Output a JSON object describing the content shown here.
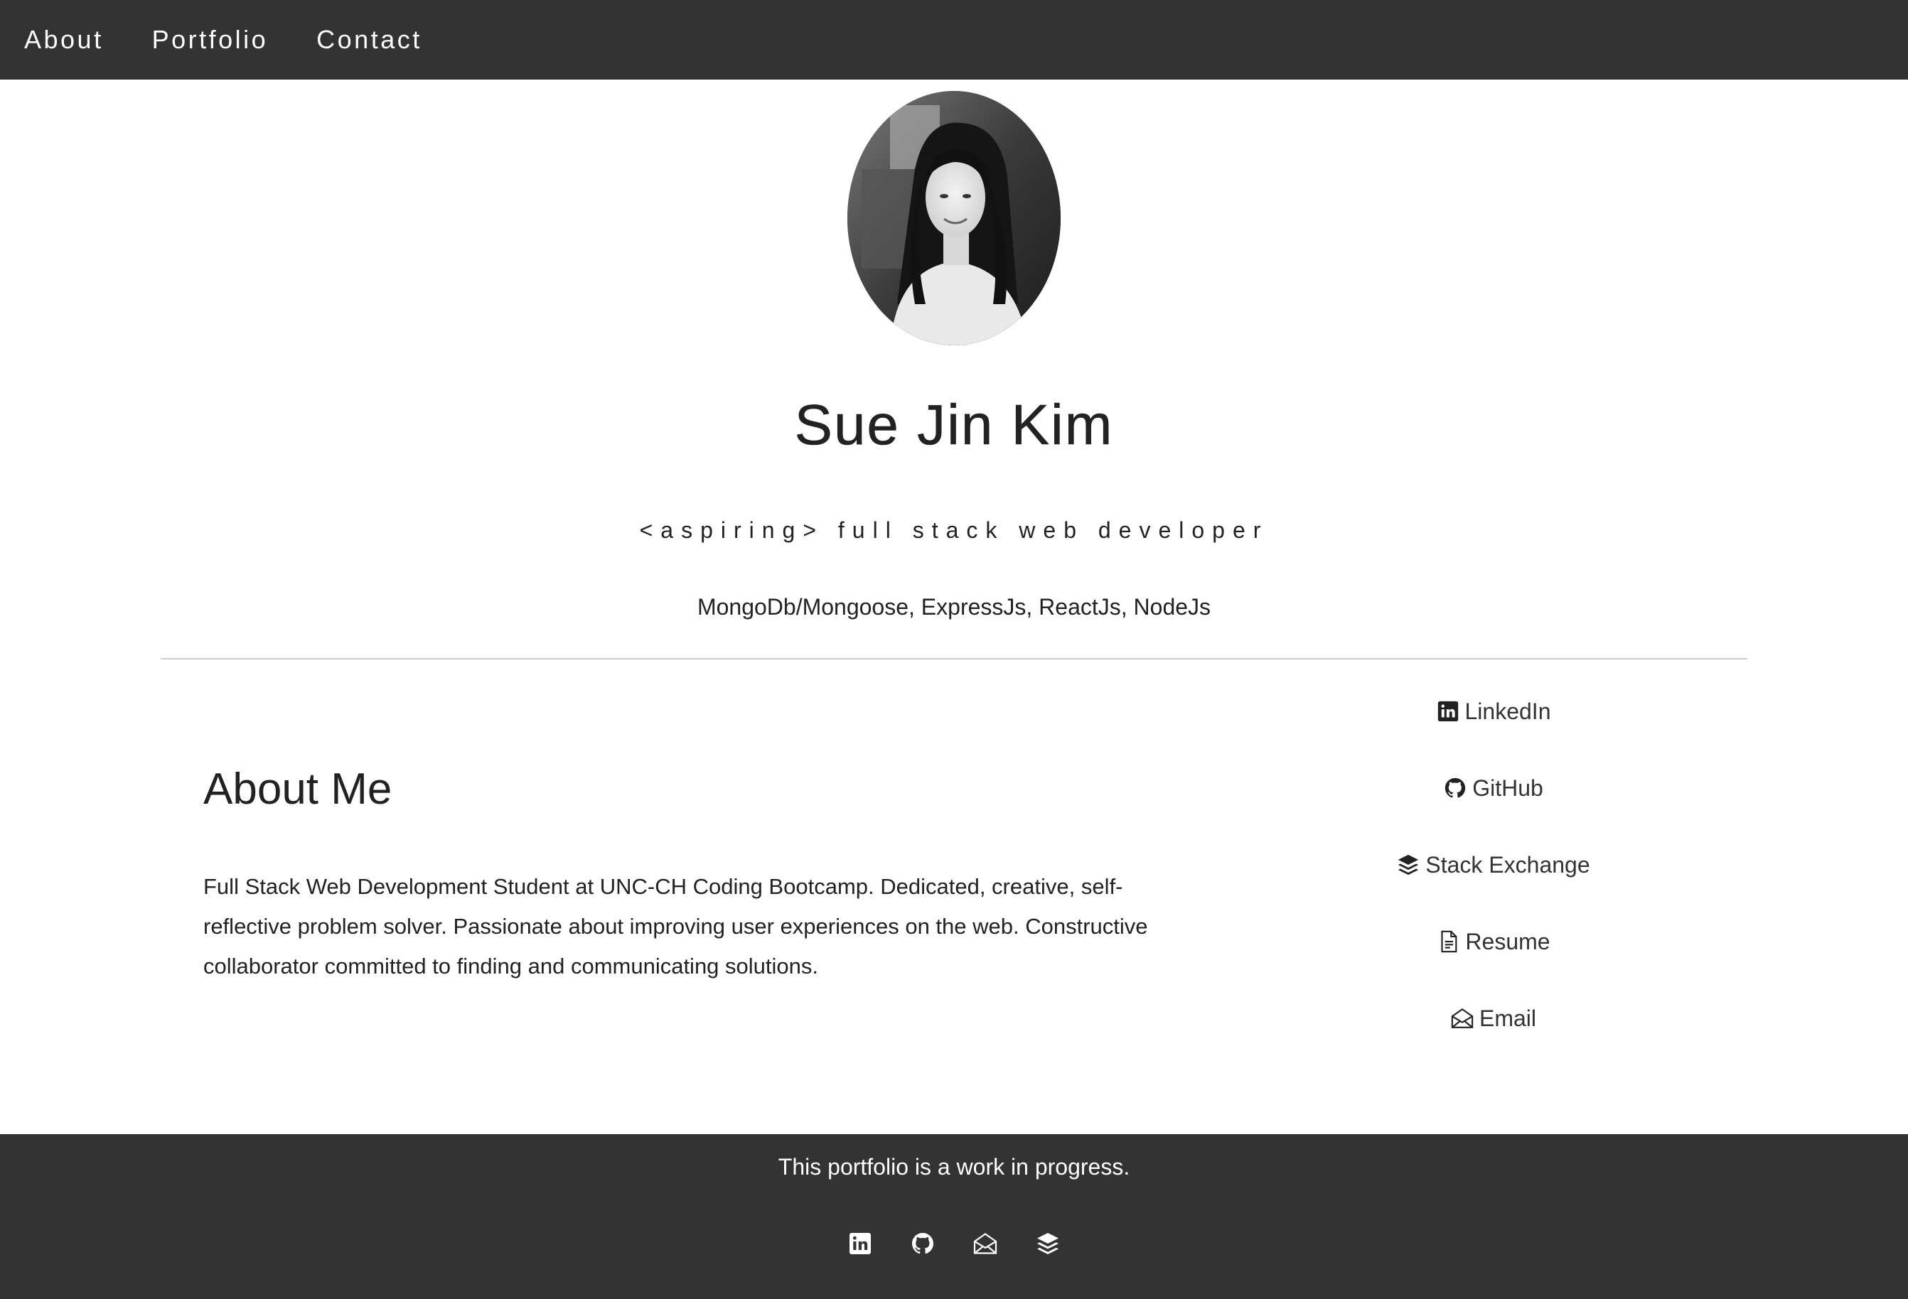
{
  "nav": {
    "items": [
      {
        "label": "About"
      },
      {
        "label": "Portfolio"
      },
      {
        "label": "Contact"
      }
    ]
  },
  "profile": {
    "avatar_icon": "profile-photo",
    "name": "Sue Jin Kim",
    "tagline": "<aspiring> full stack web developer",
    "stack": "MongoDb/Mongoose, ExpressJs, ReactJs, NodeJs"
  },
  "about": {
    "title": "About Me",
    "body": "Full Stack Web Development Student at UNC-CH Coding Bootcamp. Dedicated, creative, self-reflective problem solver. Passionate about improving user experiences on the web. Constructive collaborator committed to finding and communicating solutions."
  },
  "links": [
    {
      "label": "LinkedIn",
      "icon": "linkedin-icon"
    },
    {
      "label": "GitHub",
      "icon": "github-icon"
    },
    {
      "label": "Stack Exchange",
      "icon": "stack-exchange-icon"
    },
    {
      "label": "Resume",
      "icon": "document-icon"
    },
    {
      "label": "Email",
      "icon": "envelope-icon"
    }
  ],
  "footer": {
    "text": "This portfolio is a work in progress.",
    "icons": [
      "linkedin-icon",
      "github-icon",
      "envelope-icon",
      "stack-exchange-icon"
    ]
  },
  "colors": {
    "nav_bg": "#333333",
    "footer_bg": "#333333",
    "text": "#222222",
    "divider": "#cccccc"
  }
}
